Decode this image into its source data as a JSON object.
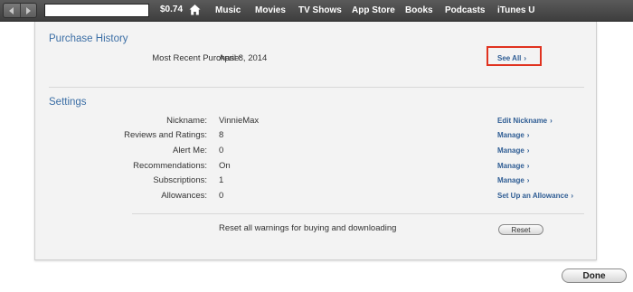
{
  "toolbar": {
    "back_icon": "back-arrow-icon",
    "forward_icon": "forward-arrow-icon",
    "account_name": "",
    "balance": "$0.74",
    "home_icon": "home-icon",
    "nav_items": [
      "Music",
      "Movies",
      "TV Shows",
      "App Store",
      "Books",
      "Podcasts",
      "iTunes U"
    ]
  },
  "purchase_history": {
    "title": "Purchase History",
    "most_recent_label": "Most Recent Purchase:",
    "most_recent_value": "April 8, 2014",
    "see_all": "See All",
    "highlight_color": "#e0321f"
  },
  "settings": {
    "title": "Settings",
    "rows": [
      {
        "label": "Nickname:",
        "value": "VinnieMax",
        "action": "Edit Nickname"
      },
      {
        "label": "Reviews and Ratings:",
        "value": "8",
        "action": "Manage"
      },
      {
        "label": "Alert Me:",
        "value": "0",
        "action": "Manage"
      },
      {
        "label": "Recommendations:",
        "value": "On",
        "action": "Manage"
      },
      {
        "label": "Subscriptions:",
        "value": "1",
        "action": "Manage"
      },
      {
        "label": "Allowances:",
        "value": "0",
        "action": "Set Up an Allowance"
      }
    ],
    "reset_text": "Reset all warnings for buying and downloading",
    "reset_button": "Reset"
  },
  "footer": {
    "done_button": "Done"
  },
  "colors": {
    "section_title": "#3b6ea5",
    "link": "#2f5d94",
    "toolbar": "#4a4a4a"
  }
}
